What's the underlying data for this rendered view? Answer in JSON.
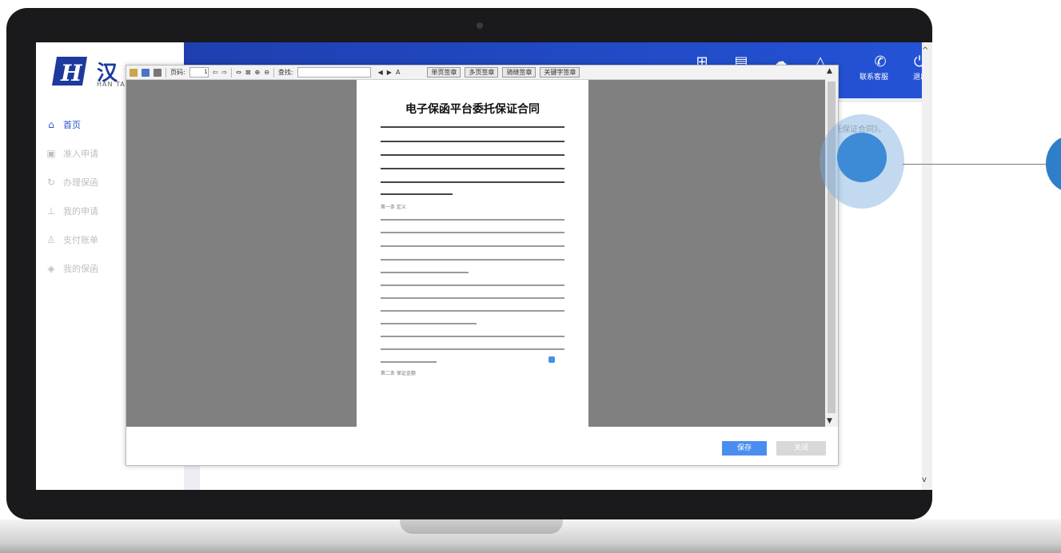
{
  "app": {
    "logo_text": "汉",
    "logo_text_partial": "汉",
    "logo_sub": "HAN TAI"
  },
  "topbar": {
    "contact_label": "联系客服",
    "logout_label": "退出"
  },
  "sidebar": {
    "items": [
      {
        "label": "首页",
        "icon": "home-icon"
      },
      {
        "label": "准入申请",
        "icon": "document-icon"
      },
      {
        "label": "办理保函",
        "icon": "refresh-icon"
      },
      {
        "label": "我的申请",
        "icon": "stamp-icon"
      },
      {
        "label": "支付账单",
        "icon": "user-icon"
      },
      {
        "label": "我的保函",
        "icon": "layers-icon"
      }
    ]
  },
  "content": {
    "snippet": "托保证合同》。"
  },
  "viewer_toolbar": {
    "page_label": "页码:",
    "page_number": "1",
    "find_label": "查找:",
    "font_size_label": "A",
    "buttons": [
      "单页签章",
      "多页签章",
      "骑缝签章",
      "关键字签章"
    ]
  },
  "document": {
    "title": "电子保函平台委托保证合同",
    "section_1": "第一条 定义",
    "section_2": "第二条 保证金额"
  },
  "modal_buttons": {
    "save": "保存",
    "close": "关闭"
  },
  "colors": {
    "topbar": "#2453d6",
    "primary_button": "#4a8df0",
    "touch_indicator": "#3d8ad6"
  }
}
